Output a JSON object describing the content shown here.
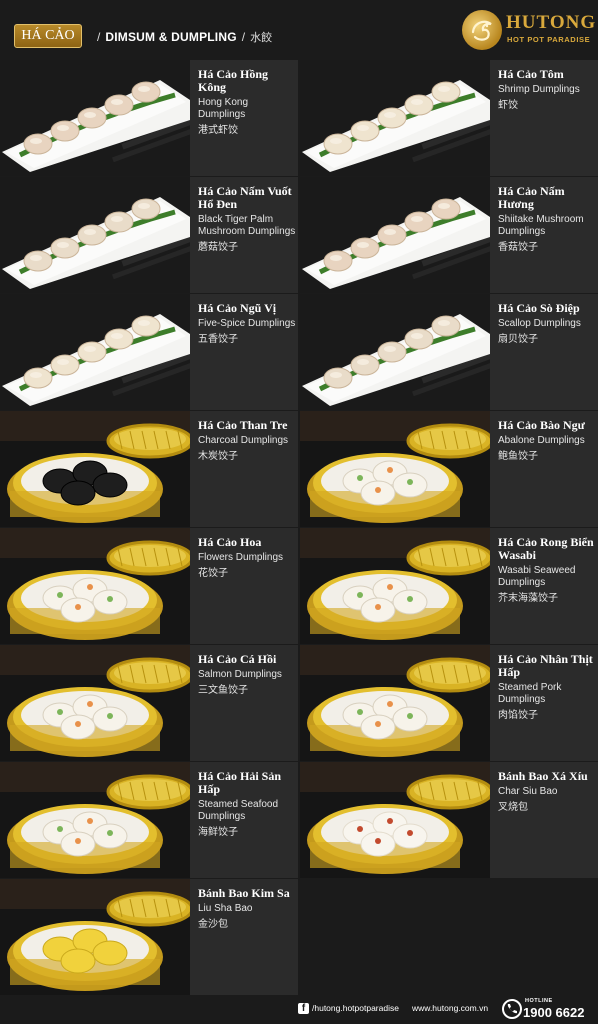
{
  "header": {
    "category_badge": "HÁ CẢO",
    "separator": "/",
    "section_title": "DIMSUM & DUMPLING",
    "section_title_zh": "水餃"
  },
  "brand": {
    "name": "HUTONG",
    "tagline": "HOT POT PARADISE",
    "color": "#d9a93c"
  },
  "items": [
    {
      "name": "Há Cảo Hồng Kông",
      "en": "Hong Kong Dumplings",
      "zh": "港式虾饺",
      "photo": "plate"
    },
    {
      "name": "Há Cảo Tôm",
      "en": "Shrimp Dumplings",
      "zh": "虾饺",
      "photo": "plate"
    },
    {
      "name": "Há Cảo Nấm Vuốt Hổ Đen",
      "en": "Black Tiger Palm Mushroom Dumplings",
      "zh": "蘑菇饺子",
      "photo": "plate"
    },
    {
      "name": "Há Cảo Nấm Hương",
      "en": "Shiitake Mushroom Dumplings",
      "zh": "香菇饺子",
      "photo": "plate"
    },
    {
      "name": "Há Cảo Ngũ Vị",
      "en": "Five-Spice Dumplings",
      "zh": "五香饺子",
      "photo": "plate"
    },
    {
      "name": "Há Cảo Sò Điệp",
      "en": "Scallop Dumplings",
      "zh": "扇贝饺子",
      "photo": "plate"
    },
    {
      "name": "Há Cảo Than Tre",
      "en": "Charcoal Dumplings",
      "zh": "木炭饺子",
      "photo": "steamer-black"
    },
    {
      "name": "Há Cảo Bào Ngư",
      "en": "Abalone Dumplings",
      "zh": "鲍鱼饺子",
      "photo": "steamer"
    },
    {
      "name": "Há Cảo Hoa",
      "en": "Flowers Dumplings",
      "zh": "花饺子",
      "photo": "steamer"
    },
    {
      "name": "Há Cảo Rong Biển Wasabi",
      "en": "Wasabi Seaweed Dumplings",
      "zh": "芥末海藻饺子",
      "photo": "steamer"
    },
    {
      "name": "Há Cảo Cá Hồi",
      "en": "Salmon Dumplings",
      "zh": "三文鱼饺子",
      "photo": "steamer"
    },
    {
      "name": "Há Cảo Nhân Thịt Hấp",
      "en": "Steamed Pork Dumplings",
      "zh": "肉馅饺子",
      "photo": "steamer"
    },
    {
      "name": "Há Cảo Hải Sản Hấp",
      "en": "Steamed Seafood Dumplings",
      "zh": "海鲜饺子",
      "photo": "steamer"
    },
    {
      "name": "Bánh Bao Xá Xíu",
      "en": "Char Siu Bao",
      "zh": "叉烧包",
      "photo": "steamer-bao"
    },
    {
      "name": "Bánh Bao Kim Sa",
      "en": "Liu Sha Bao",
      "zh": "金沙包",
      "photo": "steamer-yellow"
    }
  ],
  "footer": {
    "facebook_icon": "facebook-icon",
    "facebook": "/hutong.hotpotparadise",
    "website": "www.hutong.com.vn",
    "hotline_label": "HOTLINE",
    "hotline": "1900 6622"
  },
  "colors": {
    "background": "#1b1b1b",
    "card": "#2b2b2b",
    "gold": "#d9a93c"
  }
}
